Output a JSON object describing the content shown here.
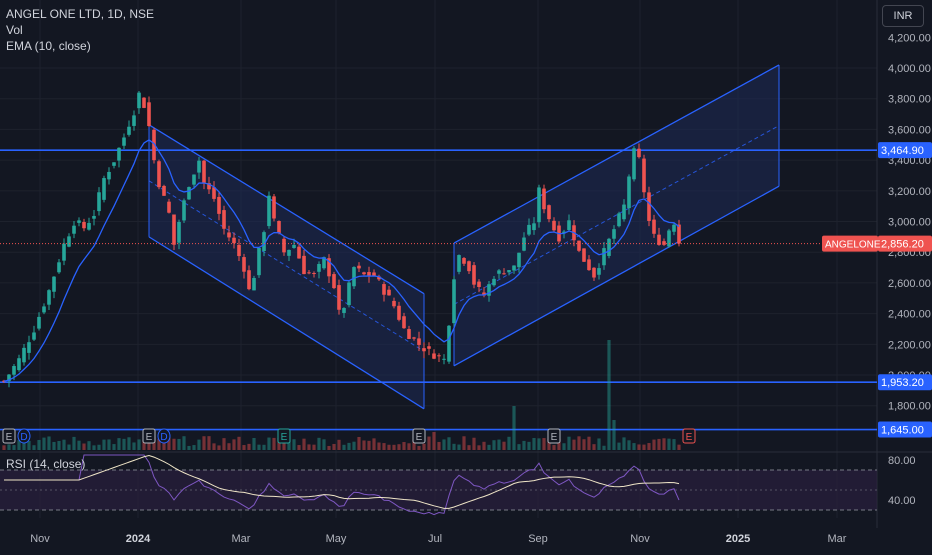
{
  "header": {
    "symbol_line": "ANGEL ONE LTD, 1D, NSE",
    "indicator_1": "Vol",
    "indicator_2": "EMA (10, close)",
    "currency": "INR",
    "rsi_label": "RSI (14, close)"
  },
  "colors": {
    "background": "#131722",
    "grid": "#1e222d",
    "up": "#26a69a",
    "down": "#ef5350",
    "ema": "#2962ff",
    "level": "#2962ff",
    "channel_fill": "#1e2a55",
    "rsi_line": "#7e57c2",
    "rsi_ma": "#f0e6c8",
    "rsi_band": "#2a1f3d"
  },
  "chart_data": {
    "type": "candlestick",
    "x_axis": {
      "ticks": [
        "Nov",
        "2024",
        "Mar",
        "May",
        "Jul",
        "Sep",
        "Nov",
        "2025",
        "Mar"
      ],
      "bold_ticks": [
        "2024",
        "2025"
      ]
    },
    "y_axis": {
      "range": [
        1645,
        4200
      ],
      "ticks": [
        "4,200.00",
        "4,000.00",
        "3,800.00",
        "3,600.00",
        "3,400.00",
        "3,200.00",
        "3,000.00",
        "2,800.00",
        "2,600.00",
        "2,400.00",
        "2,200.00",
        "2,000.00",
        "1,800.00"
      ]
    },
    "price_labels": [
      {
        "text": "3,464.90",
        "value": 3464.9,
        "kind": "level"
      },
      {
        "text": "2,856.20",
        "value": 2856.2,
        "kind": "last",
        "symbol": "ANGELONE"
      },
      {
        "text": "1,953.20",
        "value": 1953.2,
        "kind": "level"
      },
      {
        "text": "1,645.00",
        "value": 1645.0,
        "kind": "level"
      }
    ],
    "close_path": [
      [
        0,
        1960
      ],
      [
        3,
        2100
      ],
      [
        6,
        2300
      ],
      [
        9,
        2550
      ],
      [
        12,
        2850
      ],
      [
        14,
        3000
      ],
      [
        16,
        2960
      ],
      [
        18,
        3050
      ],
      [
        20,
        3280
      ],
      [
        22,
        3400
      ],
      [
        24,
        3550
      ],
      [
        25,
        3640
      ],
      [
        26,
        3720
      ],
      [
        27,
        3830
      ],
      [
        28,
        3760
      ],
      [
        29,
        3620
      ],
      [
        30,
        3400
      ],
      [
        31,
        3250
      ],
      [
        33,
        3050
      ],
      [
        34,
        2850
      ],
      [
        35,
        3000
      ],
      [
        37,
        3250
      ],
      [
        39,
        3400
      ],
      [
        40,
        3250
      ],
      [
        42,
        3150
      ],
      [
        44,
        2950
      ],
      [
        46,
        2850
      ],
      [
        48,
        2700
      ],
      [
        49,
        2550
      ],
      [
        50,
        2650
      ],
      [
        52,
        2950
      ],
      [
        53,
        3180
      ],
      [
        54,
        3000
      ],
      [
        56,
        2800
      ],
      [
        58,
        2850
      ],
      [
        60,
        2680
      ],
      [
        62,
        2650
      ],
      [
        64,
        2750
      ],
      [
        66,
        2580
      ],
      [
        67,
        2400
      ],
      [
        68,
        2450
      ],
      [
        70,
        2700
      ],
      [
        72,
        2650
      ],
      [
        74,
        2650
      ],
      [
        76,
        2550
      ],
      [
        78,
        2450
      ],
      [
        80,
        2300
      ],
      [
        82,
        2230
      ],
      [
        83,
        2200
      ],
      [
        85,
        2150
      ],
      [
        87,
        2120
      ],
      [
        88,
        2100
      ],
      [
        89,
        2350
      ],
      [
        90,
        2650
      ],
      [
        91,
        2780
      ],
      [
        92,
        2750
      ],
      [
        93,
        2700
      ],
      [
        94,
        2600
      ],
      [
        95,
        2550
      ],
      [
        96,
        2520
      ],
      [
        98,
        2650
      ],
      [
        100,
        2680
      ],
      [
        102,
        2700
      ],
      [
        104,
        2900
      ],
      [
        106,
        3000
      ],
      [
        107,
        3200
      ],
      [
        108,
        3100
      ],
      [
        110,
        2950
      ],
      [
        111,
        2900
      ],
      [
        113,
        3000
      ],
      [
        115,
        2800
      ],
      [
        117,
        2700
      ],
      [
        118,
        2650
      ],
      [
        120,
        2800
      ],
      [
        122,
        2950
      ],
      [
        124,
        3100
      ],
      [
        125,
        3300
      ],
      [
        126,
        3450
      ],
      [
        127,
        3400
      ],
      [
        128,
        3200
      ],
      [
        129,
        3000
      ],
      [
        130,
        2900
      ],
      [
        132,
        2850
      ],
      [
        133,
        2950
      ],
      [
        134,
        3000
      ],
      [
        135,
        2856
      ]
    ],
    "channels": [
      {
        "name": "descending",
        "upper": [
          [
            29,
            3630
          ],
          [
            84,
            2530
          ]
        ],
        "lower": [
          [
            29,
            2900
          ],
          [
            84,
            1780
          ]
        ]
      },
      {
        "name": "ascending",
        "upper": [
          [
            90,
            2860
          ],
          [
            155,
            4020
          ]
        ],
        "lower": [
          [
            90,
            2060
          ],
          [
            155,
            3230
          ]
        ]
      }
    ],
    "horizontal_levels": [
      3464.9,
      1953.2,
      1645.0
    ],
    "event_markers": [
      {
        "letter": "E",
        "bar": 1
      },
      {
        "letter": "D",
        "bar": 4
      },
      {
        "letter": "E",
        "bar": 29
      },
      {
        "letter": "D",
        "bar": 32
      },
      {
        "letter": "E",
        "bar": 56
      },
      {
        "letter": "E",
        "bar": 83
      },
      {
        "letter": "E",
        "bar": 110
      },
      {
        "letter": "E",
        "bar": 137
      }
    ],
    "rsi": {
      "range": [
        20,
        100
      ],
      "ticks": [
        "80.00",
        "40.00"
      ],
      "upper_band": 70,
      "lower_band": 30,
      "last_value": 40
    }
  }
}
